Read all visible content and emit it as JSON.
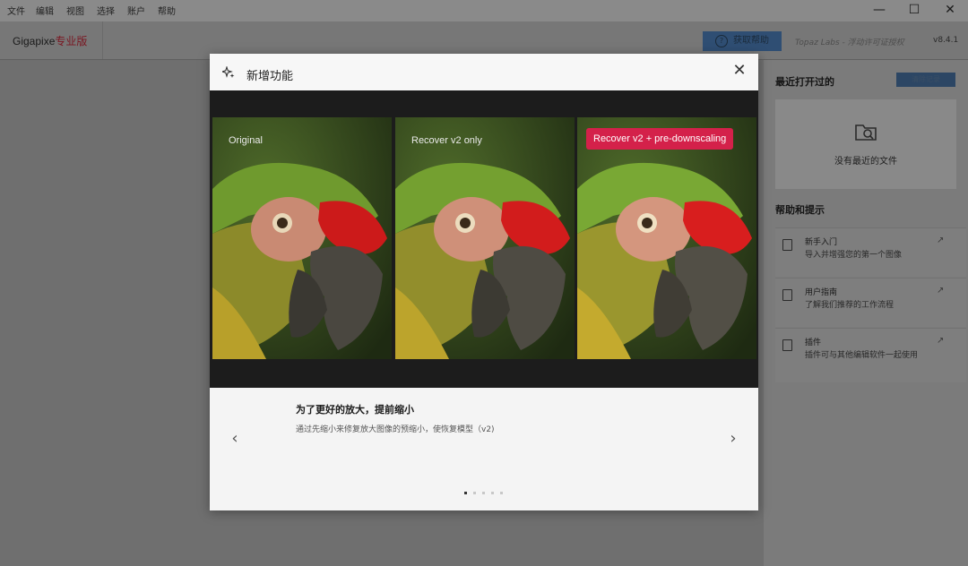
{
  "menu": [
    "文件",
    "编辑",
    "视图",
    "选择",
    "账户",
    "帮助"
  ],
  "window_controls": {
    "minimize": "—",
    "maximize": "☐",
    "close": "✕"
  },
  "app": {
    "brand_main": "Gigapixe",
    "brand_pro": "专业版",
    "help_button": "获取帮助",
    "help_icon_glyph": "?",
    "license": "Topaz Labs - 浮动许可证授权",
    "version": "v8.4.1"
  },
  "recent": {
    "title": "最近打开过的",
    "clear_button": "清除记录",
    "empty_text": "没有最近的文件"
  },
  "help": {
    "title": "帮助和提示",
    "items": [
      {
        "title": "新手入门",
        "subtitle": "导入并增强您的第一个图像"
      },
      {
        "title": "用户指南",
        "subtitle": "了解我们推荐的工作流程"
      },
      {
        "title": "插件",
        "subtitle": "插件可与其他编辑软件一起使用"
      }
    ],
    "external_link_glyph": "↗"
  },
  "modal": {
    "title": "新增功能",
    "close_glyph": "✕",
    "panels": [
      {
        "label": "Original"
      },
      {
        "label": "Recover v2 only"
      },
      {
        "label": "Recover v2 + pre-downscaling"
      }
    ],
    "slide_heading": "为了更好的放大，提前缩小",
    "slide_description": "通过先缩小来修复放大图像的预缩小，使恢复模型（v2)",
    "prev_glyph": "‹",
    "next_glyph": "›",
    "slide_count": 5,
    "active_slide": 1
  },
  "colors": {
    "accent_badge": "#d4214a",
    "help_button": "#2f4e73"
  }
}
